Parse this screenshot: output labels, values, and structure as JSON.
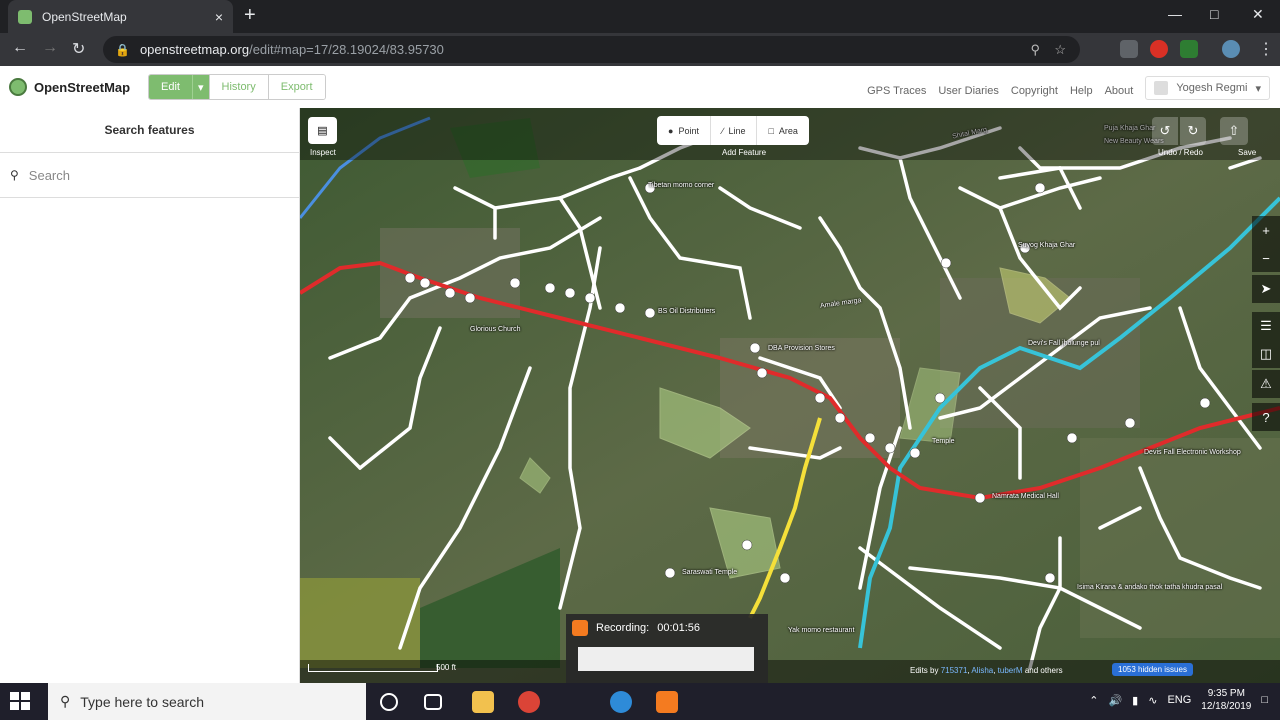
{
  "browser": {
    "tab_title": "OpenStreetMap",
    "tab_close": "×",
    "new_tab": "+",
    "url_host": "openstreetmap.org",
    "url_path": "/edit#map=17/28.19024/83.95730"
  },
  "osm_header": {
    "logo_text": "OpenStreetMap",
    "edit": "Edit",
    "history": "History",
    "export": "Export",
    "nav": [
      "GPS Traces",
      "User Diaries",
      "Copyright",
      "Help",
      "About"
    ],
    "user": "Yogesh Regmi"
  },
  "sidebar": {
    "title": "Search features",
    "search_placeholder": "Search"
  },
  "editor": {
    "inspect": "Inspect",
    "point": "Point",
    "line": "Line",
    "area": "Area",
    "add_feature": "Add Feature",
    "undo_redo": "Undo / Redo",
    "save": "Save"
  },
  "map_labels": [
    {
      "text": "Tibetan momo corner"
    },
    {
      "text": "Suyog Khaja Ghar"
    },
    {
      "text": "BS Oil Distributers"
    },
    {
      "text": "Glorious Church"
    },
    {
      "text": "Amale marga"
    },
    {
      "text": "DBA Provision Stores"
    },
    {
      "text": "Devi's Fall jholunge pul"
    },
    {
      "text": "Temple"
    },
    {
      "text": "Devis Fall Electronic Workshop"
    },
    {
      "text": "Namrata Medical Hall"
    },
    {
      "text": "Saraswati Temple"
    },
    {
      "text": "Isima Kirana & andako thok tatha khudra pasal"
    },
    {
      "text": "Yak momo restaurant"
    },
    {
      "text": "Shital Marg"
    },
    {
      "text": "Puja Khaja Ghar"
    },
    {
      "text": "New Beauty Wears"
    }
  ],
  "map_footer": {
    "scale": "500 ft",
    "edits_prefix": "Edits by",
    "editor1": "715371",
    "editor2": "Alisha",
    "editor3": "tuberM",
    "and": "and",
    "others": "others",
    "issues": "1053 hidden issues"
  },
  "recording": {
    "label": "Recording:",
    "time": "00:01:56"
  },
  "taskbar": {
    "search_placeholder": "Type here to search",
    "lang": "ENG",
    "time": "9:35 PM",
    "date": "12/18/2019"
  }
}
